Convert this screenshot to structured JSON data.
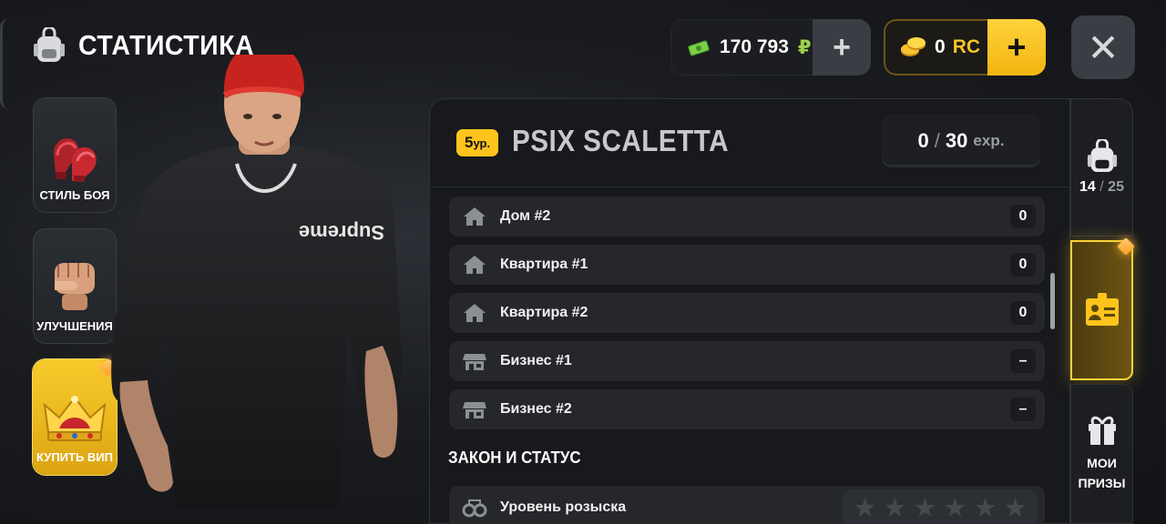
{
  "header": {
    "title": "СТАТИСТИКА"
  },
  "currency": {
    "cash_value": "170 793",
    "cash_unit": "₽",
    "rc_value": "0",
    "rc_unit": "RC",
    "plus_symbol": "+",
    "close_symbol": "✕"
  },
  "left_menu": [
    {
      "label": "СТИЛЬ БОЯ",
      "icon": "boxing-gloves-icon"
    },
    {
      "label": "УЛУЧШЕНИЯ",
      "icon": "fist-icon"
    },
    {
      "label": "КУПИТЬ ВИП",
      "icon": "crown-icon"
    }
  ],
  "character": {
    "shirt_text": "Supreme"
  },
  "profile": {
    "level_number": "5",
    "level_unit": "ур.",
    "name": "PSIX SCALETTA",
    "exp_current": "0",
    "exp_separator": "/",
    "exp_max": "30",
    "exp_unit": "exp."
  },
  "property_rows": [
    {
      "label": "Дом #2",
      "value": "0",
      "icon": "house-icon"
    },
    {
      "label": "Квартира #1",
      "value": "0",
      "icon": "house-icon"
    },
    {
      "label": "Квартира #2",
      "value": "0",
      "icon": "house-icon"
    },
    {
      "label": "Бизнес #1",
      "value": "–",
      "icon": "shop-icon"
    },
    {
      "label": "Бизнес #2",
      "value": "–",
      "icon": "shop-icon"
    }
  ],
  "law_section": {
    "title": "ЗАКОН И СТАТУС",
    "wanted_label": "Уровень розыска",
    "wanted_level": 0,
    "wanted_max": 6,
    "star_glyph": "★"
  },
  "right_tabs": {
    "inventory_count": "14",
    "inventory_separator": "/",
    "inventory_max": "25",
    "prizes_line1": "МОИ",
    "prizes_line2": "ПРИЗЫ"
  },
  "colors": {
    "accent": "#ffc41c",
    "panel": "#17191c",
    "row": "#25272b"
  }
}
